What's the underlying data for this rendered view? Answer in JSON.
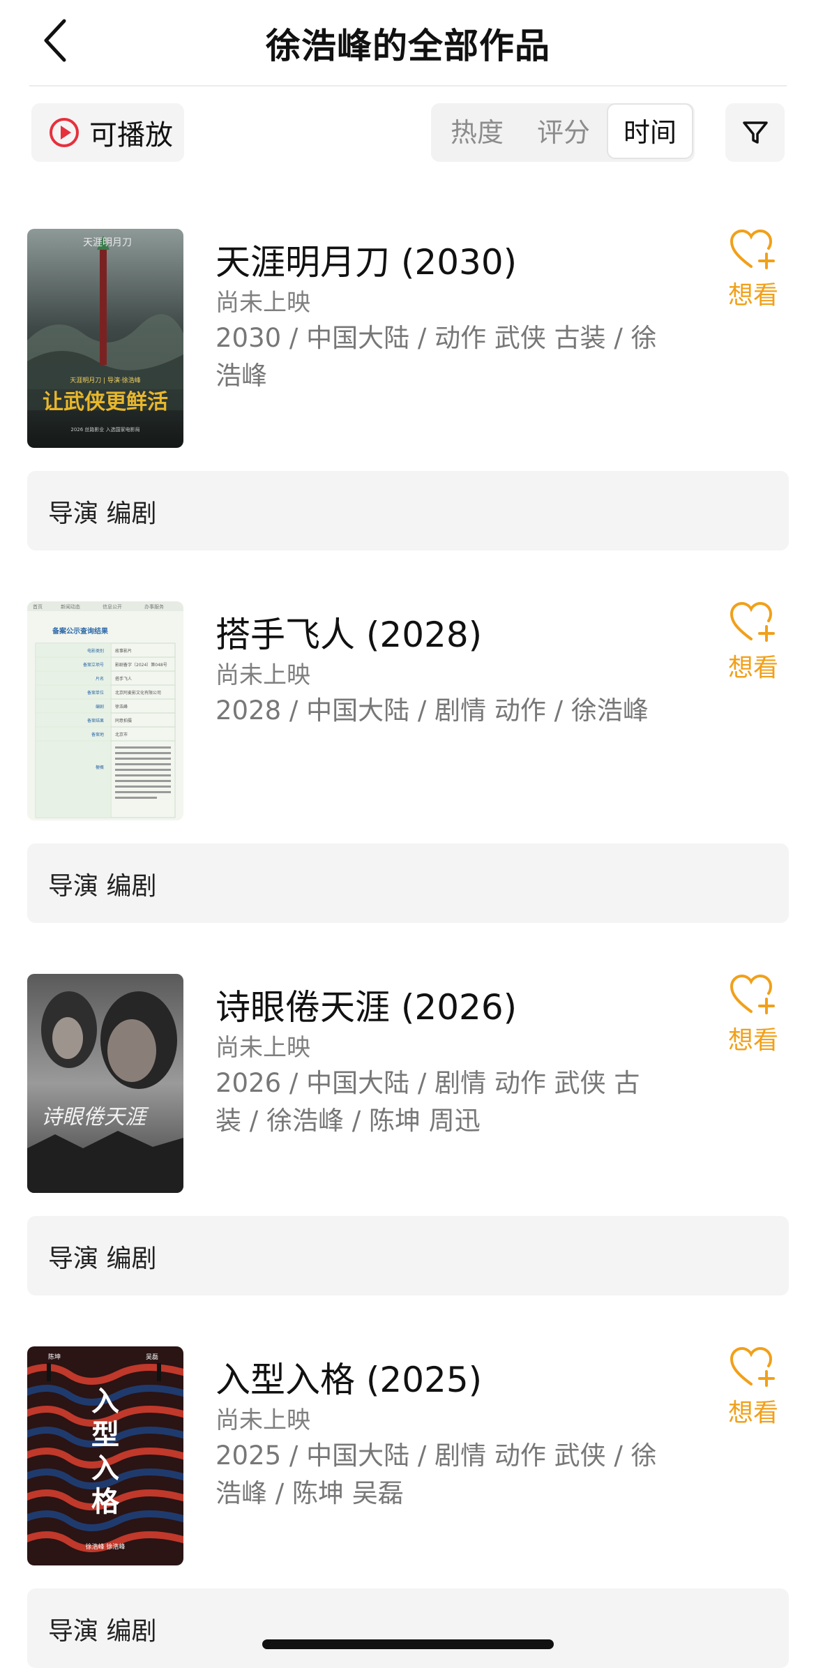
{
  "header": {
    "title": "徐浩峰的全部作品",
    "back_icon": "chevron-left-icon"
  },
  "toolbar": {
    "playable_label": "可播放",
    "sort_options": [
      "热度",
      "评分",
      "时间"
    ],
    "active_sort": "时间",
    "filter_icon": "filter-icon"
  },
  "colors": {
    "accent": "#f1a01a",
    "play_red": "#e6303d"
  },
  "movies": [
    {
      "title": "天涯明月刀 (2030)",
      "status": "尚未上映",
      "info": "2030 / 中国大陆 / 动作 武侠 古装 / 徐浩峰",
      "want_label": "想看",
      "roles": "导演 编剧",
      "poster_text": {
        "top": "天涯明月刀",
        "credit": "天涯明月刀 | 导演·徐浩峰",
        "slogan": "让武侠更鲜活",
        "bottom": "2026 丝路影业 入选国家电影局"
      }
    },
    {
      "title": "搭手飞人 (2028)",
      "status": "尚未上映",
      "info": "2028 / 中国大陆 / 剧情 动作 / 徐浩峰",
      "want_label": "想看",
      "roles": "导演 编剧",
      "poster_text": {
        "tabs": [
          "首页",
          "新闻动态",
          "信息公开",
          "办事服务"
        ],
        "heading": "备案公示查询结果",
        "rows": [
          [
            "电影类别",
            "故事影片"
          ],
          [
            "备案立项号",
            "影剧备字〔2024〕第048号"
          ],
          [
            "片名",
            "搭手飞人"
          ],
          [
            "备案单位",
            "北京阿麦影文化有限公司"
          ],
          [
            "编剧",
            "徐浩峰"
          ],
          [
            "备案结果",
            "同意拍摄"
          ],
          [
            "备案地",
            "北京市"
          ],
          [
            "梗概",
            "梗概：一个电影厂子弟，在电影厂自厂营开后，自忆了自己的青春和父辈往事..."
          ]
        ]
      }
    },
    {
      "title": "诗眼倦天涯 (2026)",
      "status": "尚未上映",
      "info": "2026 / 中国大陆 / 剧情 动作 武侠 古装 / 徐浩峰 / 陈坤 周迅",
      "want_label": "想看",
      "roles": "导演 编剧",
      "poster_text": {
        "title": "诗眼倦天涯"
      }
    },
    {
      "title": "入型入格 (2025)",
      "status": "尚未上映",
      "info": "2025 / 中国大陆 / 剧情 动作 武侠 / 徐浩峰 / 陈坤 吴磊",
      "want_label": "想看",
      "roles": "导演 编剧",
      "poster_text": {
        "title": "入型入格",
        "actors_top": [
          "陈坤",
          "吴磊"
        ],
        "credits": "徐浩峰 徐浩峰"
      }
    }
  ]
}
